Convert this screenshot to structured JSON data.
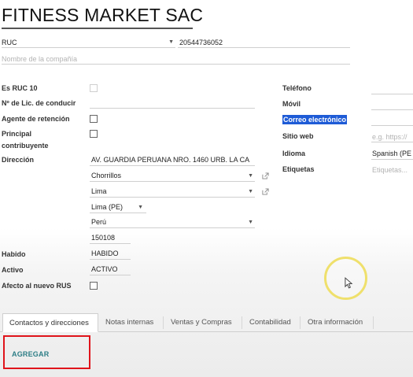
{
  "company": {
    "name": "FITNESS MARKET SAC",
    "doc_type": "RUC",
    "doc_number": "20544736052",
    "name_placeholder": "Nombre de la compañía"
  },
  "left_labels": {
    "es_ruc10": "Es RUC 10",
    "licencia": "Nº de Lic. de conducir",
    "agente": "Agente de retención",
    "principal_1": "Principal",
    "principal_2": "contribuyente",
    "direccion": "Dirección",
    "habido": "Habido",
    "activo": "Activo",
    "afecto_rus": "Afecto al nuevo RUS"
  },
  "address": {
    "street": "AV. GUARDIA PERUANA NRO. 1460 URB. LA CA",
    "district": "Chorrillos",
    "province": "Lima",
    "state": "Lima (PE)",
    "country": "Perú",
    "zip": "150108"
  },
  "status": {
    "habido": "HABIDO",
    "activo": "ACTIVO"
  },
  "right_labels": {
    "telefono": "Teléfono",
    "movil": "Móvil",
    "correo": "Correo electrónico",
    "sitio": "Sitio web",
    "idioma": "Idioma",
    "etiquetas": "Etiquetas"
  },
  "right_values": {
    "sitio_placeholder": "e.g. https://",
    "idioma_value": "Spanish (PE",
    "etiquetas_placeholder": "Etiquetas..."
  },
  "tabs": [
    {
      "label": "Contactos y direcciones",
      "active": true
    },
    {
      "label": "Notas internas",
      "active": false
    },
    {
      "label": "Ventas y Compras",
      "active": false
    },
    {
      "label": "Contabilidad",
      "active": false
    },
    {
      "label": "Otra información",
      "active": false
    }
  ],
  "add_button": "AGREGAR",
  "colors": {
    "accent_teal": "#2d7e86",
    "highlight": "#1e5bd6",
    "annotation_red": "#e0141b"
  }
}
